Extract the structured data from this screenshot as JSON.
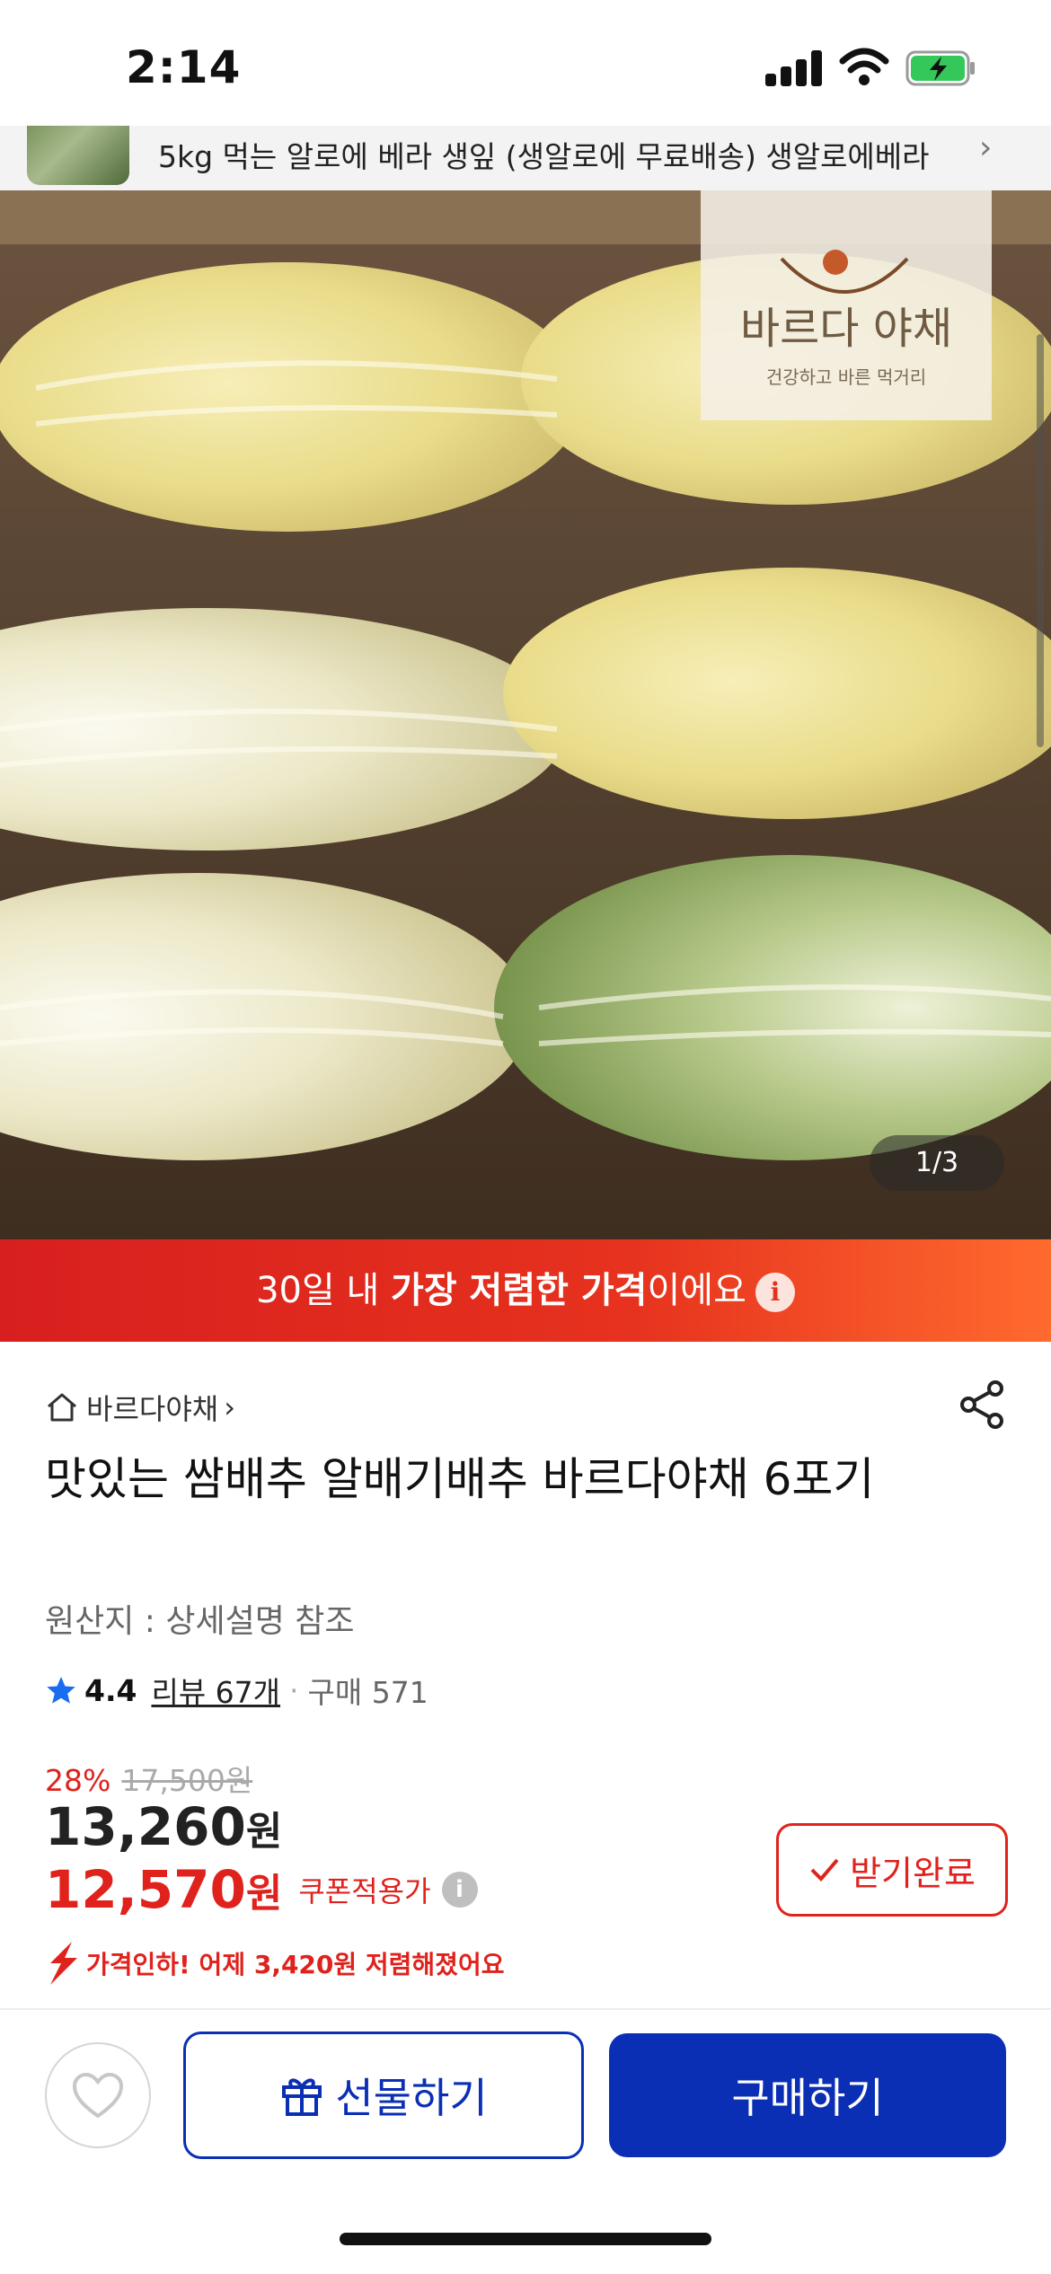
{
  "status_bar": {
    "time": "2:14"
  },
  "related": {
    "text": "5kg 먹는 알로에 베라 생잎 (생알로에 무료배송) 생알로에베라"
  },
  "hero": {
    "logo_title": "바르다 야채",
    "logo_subtitle": "건강하고 바른 먹거리",
    "counter": "1/3"
  },
  "banner": {
    "prefix": "30일 내 ",
    "highlight": "가장 저렴한 가격",
    "suffix": "이에요"
  },
  "product": {
    "store": "바르다야채",
    "title": "맛있는 쌈배추 알배기배추 바르다야채 6포기",
    "origin": "원산지 : 상세설명 참조",
    "rating": "4.4",
    "review": "리뷰 67개",
    "purchase": "구매 571"
  },
  "price": {
    "discount_rate": "28%",
    "original": "17,500원",
    "sale_number": "13,260",
    "sale_unit": "원",
    "coupon_number": "12,570",
    "coupon_unit": "원",
    "coupon_label": "쿠폰적용가",
    "received_label": "받기완료",
    "drop_text": "가격인하! 어제 3,420원 저렴해졌어요"
  },
  "bottom": {
    "gift_label": "선물하기",
    "buy_label": "구매하기"
  },
  "colors": {
    "accent_red": "#e0221c",
    "brand_blue": "#0a2fb5",
    "star_blue": "#1a6cf0"
  }
}
